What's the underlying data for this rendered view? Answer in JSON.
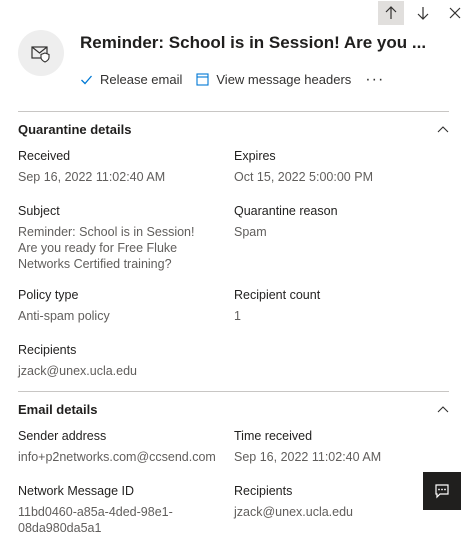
{
  "header": {
    "title": "Reminder: School is in Session! Are you ..."
  },
  "actions": {
    "release_label": "Release email",
    "headers_label": "View message headers",
    "more_label": "···"
  },
  "quarantine": {
    "title": "Quarantine details",
    "received_label": "Received",
    "received_value": "Sep 16, 2022 11:02:40 AM",
    "expires_label": "Expires",
    "expires_value": "Oct 15, 2022 5:00:00 PM",
    "subject_label": "Subject",
    "subject_value": "Reminder: School is in Session! Are you ready for Free Fluke Networks Certified training?",
    "reason_label": "Quarantine reason",
    "reason_value": "Spam",
    "policy_label": "Policy type",
    "policy_value": "Anti-spam policy",
    "rcount_label": "Recipient count",
    "rcount_value": "1",
    "recipients_label": "Recipients",
    "recipients_value": "jzack@unex.ucla.edu"
  },
  "email": {
    "title": "Email details",
    "sender_label": "Sender address",
    "sender_value": "info+p2networks.com@ccsend.com",
    "time_label": "Time received",
    "time_value": "Sep 16, 2022 11:02:40 AM",
    "netid_label": "Network Message ID",
    "netid_value": "11bd0460-a85a-4ded-98e1-08da980da5a1",
    "recipients_label": "Recipients",
    "recipients_value": "jzack@unex.ucla.edu"
  },
  "icons": {
    "up": "arrow-up-icon",
    "down": "arrow-down-icon",
    "close": "close-icon",
    "mail": "mail-shield-icon",
    "check": "checkmark-icon",
    "headers": "message-headers-icon",
    "chevron": "chevron-up-icon",
    "chat": "chat-feedback-icon"
  }
}
